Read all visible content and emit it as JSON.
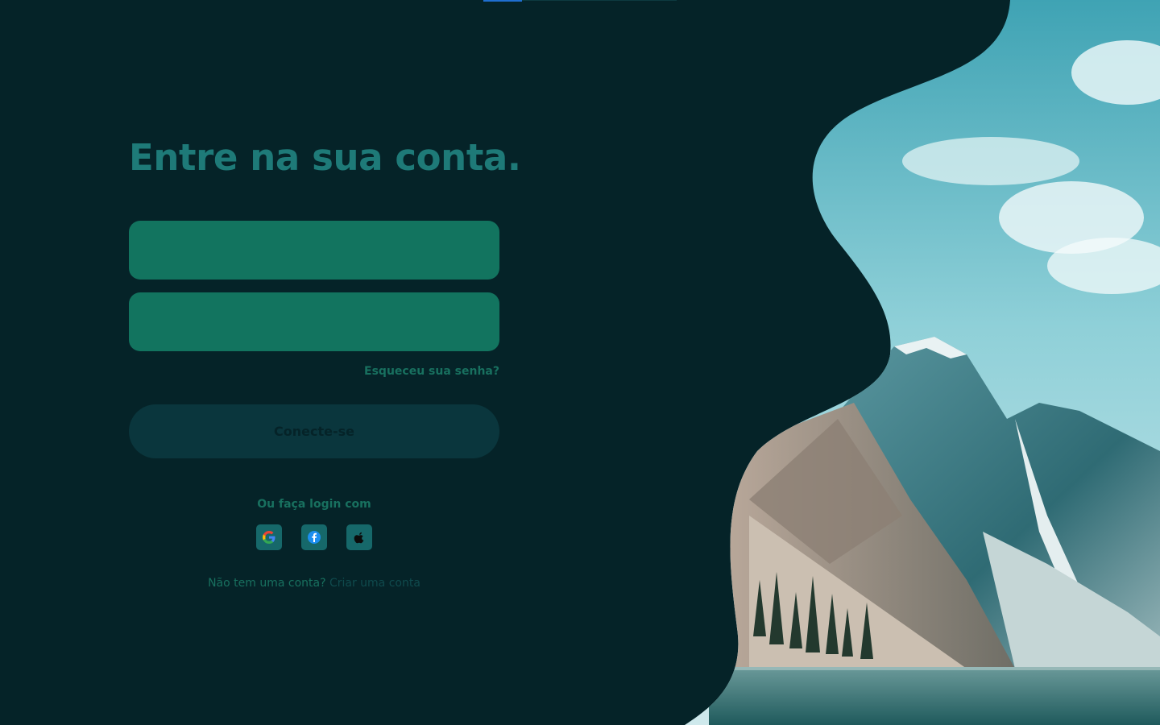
{
  "login": {
    "title": "Entre na sua conta.",
    "email_placeholder": "",
    "password_placeholder": "",
    "forgot_password": "Esqueceu sua senha?",
    "submit_label": "Conecte-se",
    "social_caption": "Ou faça login com",
    "social_providers": [
      "google-icon",
      "facebook-icon",
      "apple-icon"
    ],
    "signup_prompt": "Não tem uma conta?",
    "signup_link": "Criar uma conta"
  },
  "colors": {
    "background": "#052328",
    "accent": "#1e7a78",
    "field": "#12745f",
    "button": "#0a363d",
    "social_button": "#16686a",
    "sky": "#5fb9c6",
    "lake": "#2f6e70"
  }
}
